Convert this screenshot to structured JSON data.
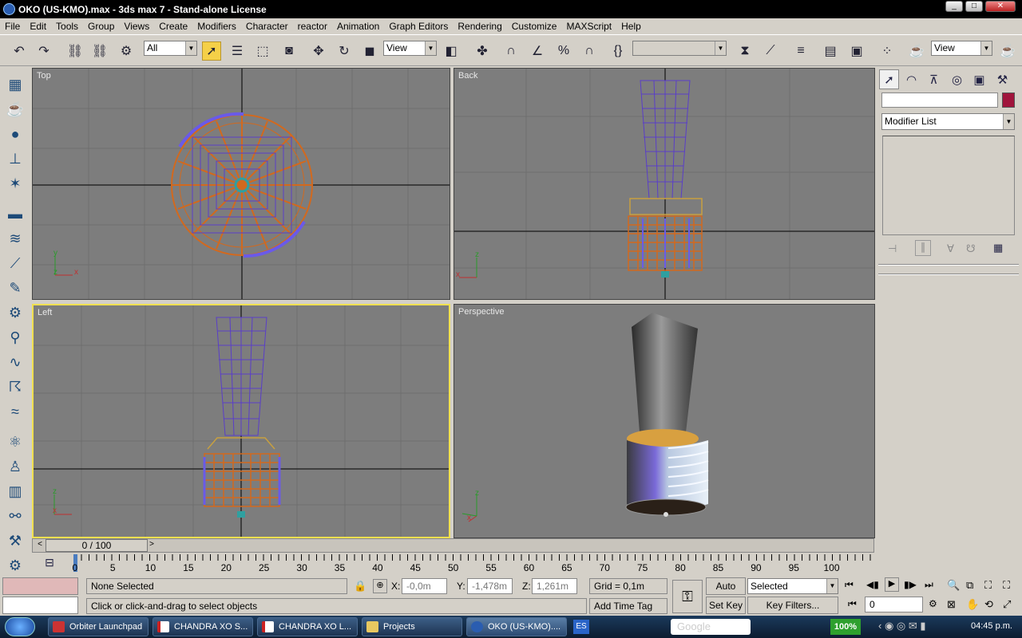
{
  "window": {
    "title": "OKO (US-KMO).max - 3ds max 7  - Stand-alone License",
    "min_label": "_",
    "max_label": "□",
    "close_label": "✕"
  },
  "menu": [
    "File",
    "Edit",
    "Tools",
    "Group",
    "Views",
    "Create",
    "Modifiers",
    "Character",
    "reactor",
    "Animation",
    "Graph Editors",
    "Rendering",
    "Customize",
    "MAXScript",
    "Help"
  ],
  "toolbar": {
    "selection_filter": "All",
    "ref_coord": "View",
    "named_sel": "",
    "render_view": "View"
  },
  "viewports": {
    "top": "Top",
    "back": "Back",
    "left": "Left",
    "perspective": "Perspective"
  },
  "axes": {
    "x": "x",
    "y": "y",
    "z": "z"
  },
  "command_panel": {
    "name_field": "",
    "modifier_list": "Modifier List",
    "color": "#a0143c"
  },
  "time_slider": {
    "label": "0 / 100",
    "current": 0,
    "total": 100
  },
  "ruler": {
    "ticks": [
      "0",
      "5",
      "10",
      "15",
      "20",
      "25",
      "30",
      "35",
      "40",
      "45",
      "50",
      "55",
      "60",
      "65",
      "70",
      "75",
      "80",
      "85",
      "90",
      "95",
      "100"
    ]
  },
  "status": {
    "selection": "None Selected",
    "prompt": "Click or click-and-drag to select objects",
    "x_label": "X:",
    "x": "-0,0m",
    "y_label": "Y:",
    "y": "-1,478m",
    "z_label": "Z:",
    "z": "1,261m",
    "grid": "Grid = 0,1m",
    "add_time_tag": "Add Time Tag",
    "auto_key": "Auto Key",
    "set_key": "Set Key",
    "key_mode": "Selected",
    "key_filters": "Key Filters...",
    "frame": "0"
  },
  "taskbar": {
    "items": [
      "Orbiter Launchpad",
      "CHANDRA XO S...",
      "CHANDRA XO L...",
      "Projects",
      "OKO (US-KMO)...."
    ],
    "lang": "ES",
    "search": "Google",
    "battery": "100%",
    "clock": "04:45 p.m."
  },
  "colors": {
    "accent_active_vp": "#f0e050",
    "wire_orange": "#d2691e",
    "wire_blue": "#5a3ec8",
    "taskbar": "#1b3a5c"
  }
}
